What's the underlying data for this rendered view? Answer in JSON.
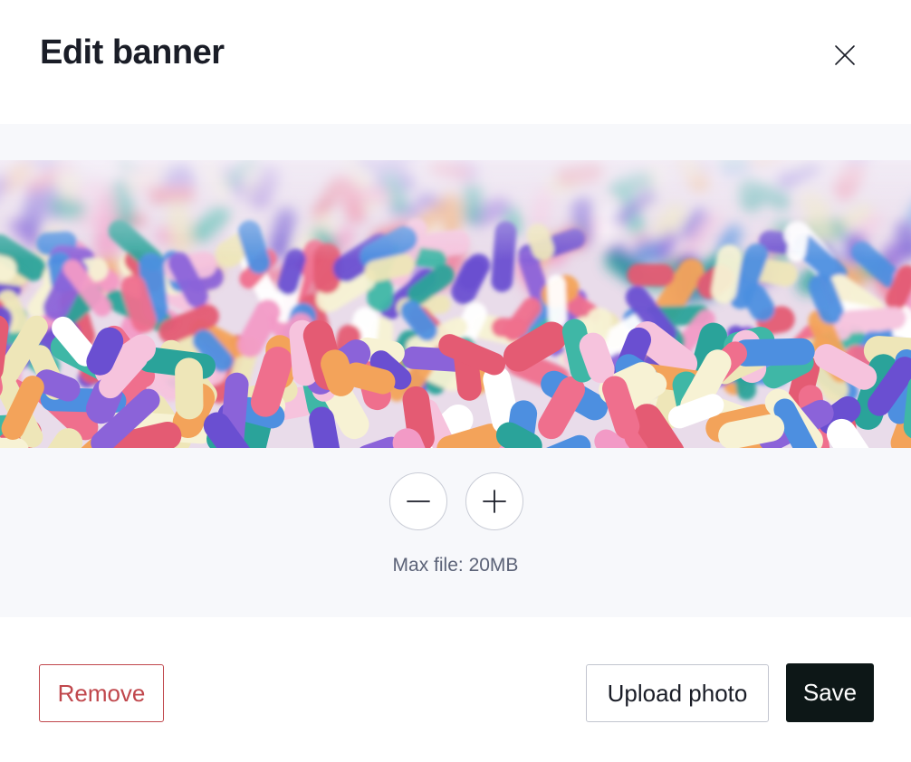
{
  "dialog": {
    "title": "Edit banner",
    "close_icon": "close-icon"
  },
  "editor": {
    "banner_image": "colorful sprinkles photo",
    "zoom_out_icon": "minus-icon",
    "zoom_in_icon": "plus-icon",
    "max_file_text": "Max file: 20MB"
  },
  "footer": {
    "remove_label": "Remove",
    "upload_label": "Upload photo",
    "save_label": "Save"
  },
  "colors": {
    "remove": "#c0474c",
    "save_bg": "#0d1717",
    "editor_bg": "#f7f8fb"
  }
}
